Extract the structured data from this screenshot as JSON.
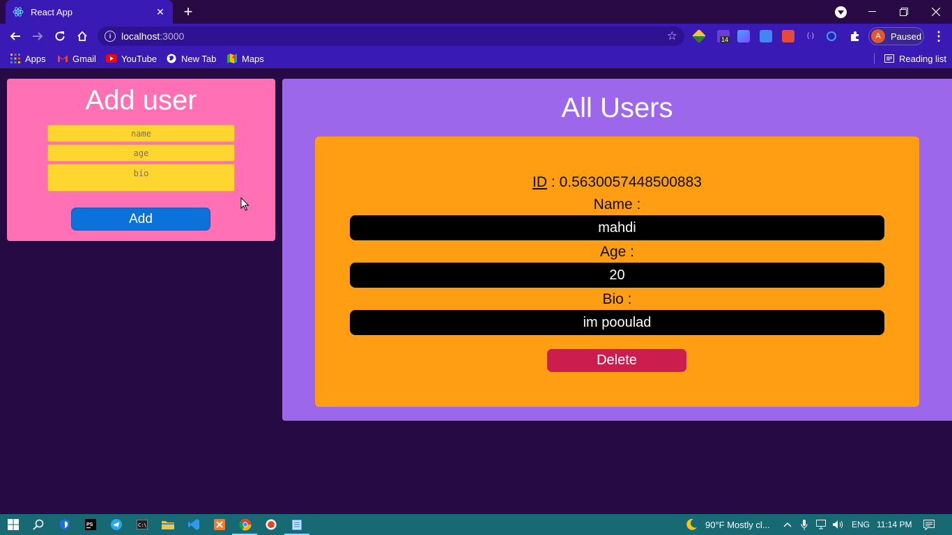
{
  "browser": {
    "tab_title": "React App",
    "url_host": "localhost",
    "url_port": ":3000",
    "profile_initial": "A",
    "profile_status": "Paused",
    "extension_badge": "14",
    "bookmarks": [
      "Apps",
      "Gmail",
      "YouTube",
      "New Tab",
      "Maps"
    ],
    "reading_list": "Reading list"
  },
  "add_user": {
    "title": "Add user",
    "name_placeholder": "name",
    "age_placeholder": "age",
    "bio_placeholder": "bio",
    "add_label": "Add"
  },
  "all_users": {
    "title": "All Users",
    "users": [
      {
        "id_label": "ID",
        "id_value": "0.5630057448500883",
        "name_label": "Name :",
        "name": "mahdi",
        "age_label": "Age :",
        "age": "20",
        "bio_label": "Bio :",
        "bio": "im pooulad",
        "delete_label": "Delete"
      }
    ]
  },
  "taskbar": {
    "weather": "90°F  Mostly cl...",
    "language": "ENG",
    "time": "11:14 PM"
  },
  "colors": {
    "page_bg": "#260a44",
    "chrome_accent": "#3a1ab4",
    "add_panel": "#ff71b4",
    "users_panel": "#9d67eb",
    "user_card": "#ff9e12",
    "input_bg": "#ffd630",
    "add_button": "#0a72d8",
    "delete_button": "#cc1e4e",
    "taskbar": "#176a73"
  }
}
